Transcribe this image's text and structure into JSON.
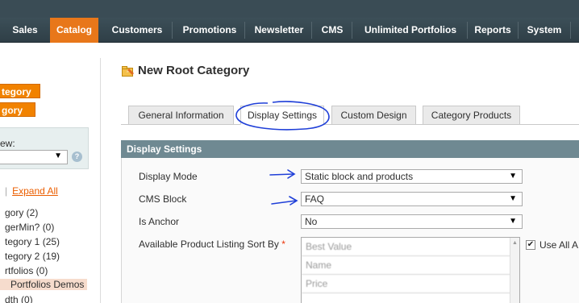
{
  "nav": {
    "items": [
      {
        "label": "Sales"
      },
      {
        "label": "Catalog"
      },
      {
        "label": "Customers"
      },
      {
        "label": "Promotions"
      },
      {
        "label": "Newsletter"
      },
      {
        "label": "CMS"
      },
      {
        "label": "Unlimited Portfolios"
      },
      {
        "label": "Reports"
      },
      {
        "label": "System"
      }
    ],
    "active": "Catalog"
  },
  "sidebar": {
    "add_root_button": "tegory",
    "add_sub_button": "gory",
    "store_view_label": "ew:",
    "store_view_value": "",
    "expand_separator": "|",
    "expand_all_link": "Expand All",
    "tree": [
      {
        "label": "gory (2)"
      },
      {
        "label": "gerMin? (0)"
      },
      {
        "label": "tegory 1 (25)"
      },
      {
        "label": "tegory 2 (19)"
      },
      {
        "label": "rtfolios (0)"
      },
      {
        "label": "Portfolios Demos"
      },
      {
        "label": "dth (0)"
      }
    ]
  },
  "page": {
    "title": "New Root Category"
  },
  "tabs": [
    {
      "label": "General Information"
    },
    {
      "label": "Display Settings"
    },
    {
      "label": "Custom Design"
    },
    {
      "label": "Category Products"
    }
  ],
  "section": {
    "title": "Display Settings"
  },
  "form": {
    "display_mode": {
      "label": "Display Mode",
      "value": "Static block and products"
    },
    "cms_block": {
      "label": "CMS Block",
      "value": "FAQ"
    },
    "is_anchor": {
      "label": "Is Anchor",
      "value": "No"
    },
    "sort_by": {
      "label": "Available Product Listing Sort By",
      "required_mark": "*",
      "options": [
        "Best Value",
        "Name",
        "Price"
      ],
      "use_all_label": "Use All A",
      "use_all_checked": true
    }
  },
  "colors": {
    "nav_active": "#e8771a",
    "section_header": "#6f8992",
    "annotation_ink": "#1f3fd8",
    "link": "#eb5e00"
  },
  "icons": {
    "help": "?",
    "checkmark": "✔",
    "dropdown": "▼",
    "scroll_up": "▲"
  }
}
